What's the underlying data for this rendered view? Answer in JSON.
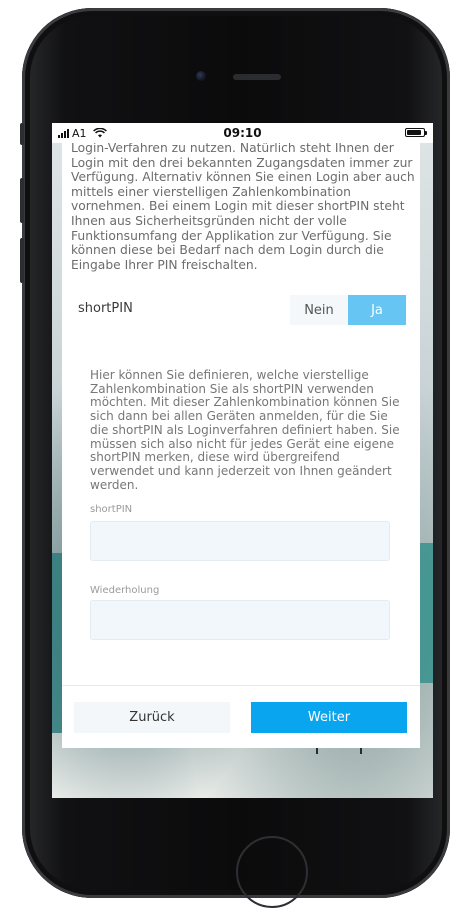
{
  "status_bar": {
    "carrier": "A1",
    "time": "09:10",
    "battery_level": 0.85
  },
  "card": {
    "intro_text": "Login-Verfahren zu nutzen. Natürlich steht Ihnen der Login mit den drei bekannten Zugangsdaten immer zur Verfügung. Alternativ können Sie einen Login aber auch mittels einer vierstelligen Zahlenkombination vornehmen. Bei einem Login mit dieser shortPIN steht Ihnen aus Sicherheitsgründen nicht der volle Funktionsumfang der Applikation zur Verfügung. Sie können diese bei Bedarf nach dem Login durch die Eingabe Ihrer PIN freischalten.",
    "shortpin_toggle": {
      "label": "shortPIN",
      "option_no": "Nein",
      "option_yes": "Ja",
      "selected": "Ja"
    },
    "info_text": "Hier können Sie definieren, welche vierstellige Zahlenkombination Sie als shortPIN verwenden möchten. Mit dieser Zahlenkombination können Sie sich dann bei allen Geräten anmelden, für die Sie die shortPIN als Loginverfahren definiert haben. Sie müssen sich also nicht für jedes Gerät eine eigene shortPIN merken, diese wird übergreifend verwendet und kann jederzeit von Ihnen geändert werden.",
    "fields": {
      "shortpin_label": "shortPIN",
      "shortpin_value": "",
      "repeat_label": "Wiederholung",
      "repeat_value": ""
    },
    "buttons": {
      "back": "Zurück",
      "next": "Weiter"
    }
  },
  "colors": {
    "accent": "#0aa5ef",
    "toggle_active": "#66c5f2",
    "field_bg": "#f2f7fb"
  }
}
